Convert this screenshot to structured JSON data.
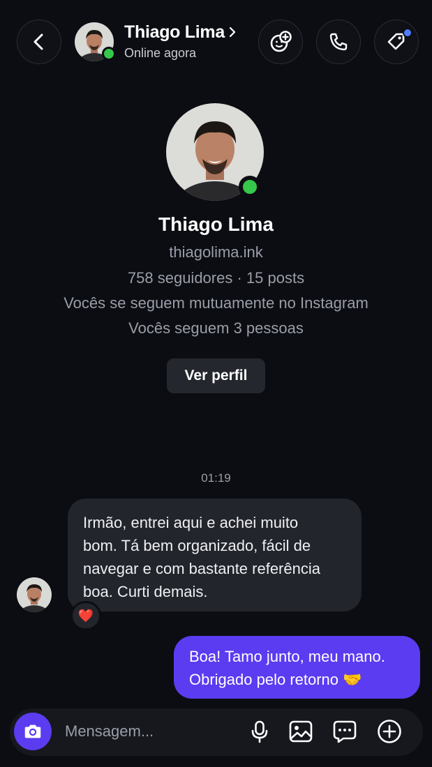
{
  "header": {
    "name": "Thiago Lima",
    "status": "Online agora",
    "icons": [
      "back-icon",
      "chevron-right-icon",
      "sticker-add-icon",
      "phone-icon",
      "tag-icon"
    ]
  },
  "profile": {
    "name": "Thiago Lima",
    "username": "thiagolima.ink",
    "stats": "758 seguidores · 15 posts",
    "mutual": "Vocês se seguem mutuamente no Instagram",
    "following": "Vocês seguem 3 pessoas",
    "view_button": "Ver perfil"
  },
  "chat": {
    "timestamp": "01:19",
    "messages": [
      {
        "from": "Thiago Lima",
        "lines": [
          "Irmão, entrei aqui e achei muito",
          "bom. Tá bem organizado, fácil de",
          "navegar e com bastante referência",
          "boa. Curti demais."
        ],
        "reaction": "❤️"
      },
      {
        "from": "me",
        "lines": [
          "Boa! Tamo junto, meu mano.",
          "Obrigado pelo retorno 🤝"
        ]
      }
    ]
  },
  "composer": {
    "placeholder": "Mensagem...",
    "icons": [
      "camera-icon",
      "microphone-icon",
      "gallery-icon",
      "chat-bubble-icon",
      "plus-circle-icon"
    ]
  },
  "colors": {
    "background": "#0b0d12",
    "accent": "#5b3cf0",
    "online": "#35c84a",
    "notification_dot": "#4f7cff",
    "bubble_incoming": "#23252c"
  }
}
